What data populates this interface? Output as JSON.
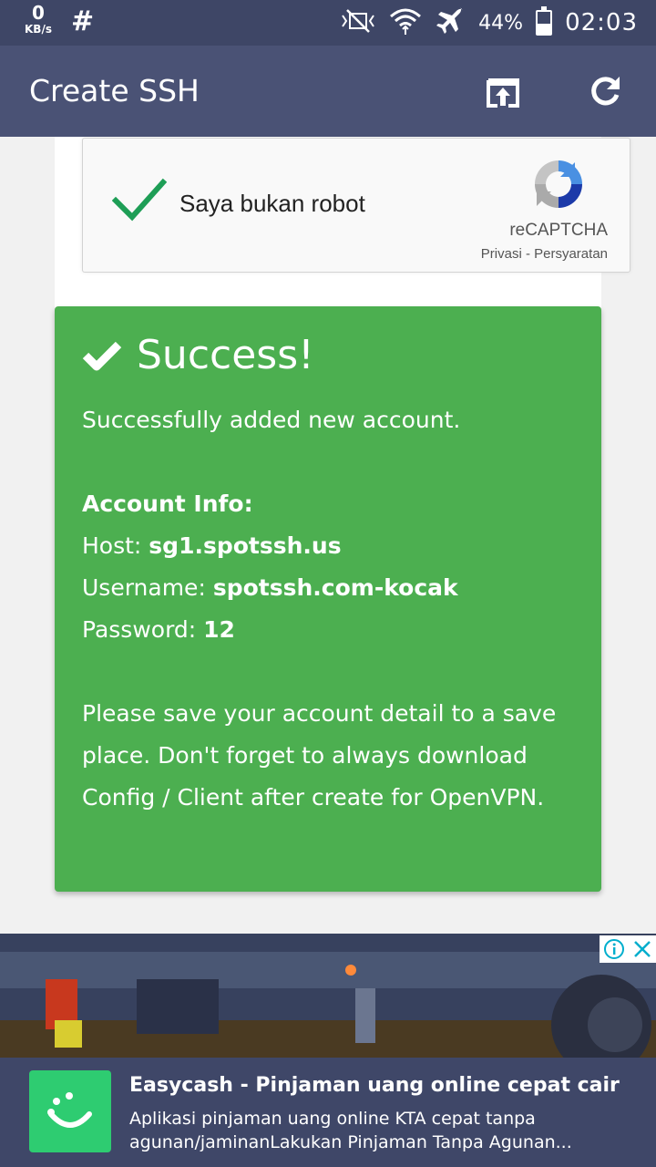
{
  "status_bar": {
    "net_speed_value": "0",
    "net_speed_unit": "KB/s",
    "hash_symbol": "#",
    "battery": "44%",
    "battery_level": 0.44,
    "time": "02:03",
    "icons": [
      "mute-icon",
      "wifi-icon",
      "airplane-icon",
      "battery-icon"
    ]
  },
  "app_bar": {
    "title": "Create SSH",
    "actions": [
      "open-in-browser-icon",
      "refresh-icon"
    ]
  },
  "recaptcha": {
    "label": "Saya bukan robot",
    "brand": "reCAPTCHA",
    "privacy": "Privasi",
    "separator": " - ",
    "terms": "Persyaratan",
    "checked": true
  },
  "alert": {
    "title": "Success!",
    "message": "Successfully added new account.",
    "info_title": "Account Info:",
    "host_label": "Host: ",
    "host_value": "sg1.spotssh.us",
    "username_label": "Username: ",
    "username_value": "spotssh.com-kocak",
    "password_label": "Password: ",
    "password_value": "12",
    "note": "Please save your account detail to a save place. Don't forget to always download Config / Client after create for OpenVPN."
  },
  "ad": {
    "title": "Easycash - Pinjaman uang online cepat cair",
    "description": "Aplikasi pinjaman uang online KTA cepat tanpa agunan/jaminanLakukan Pinjaman Tanpa Agunan...",
    "info_icon": "info-icon",
    "close_icon": "close-icon"
  },
  "colors": {
    "status_bar": "#3e4666",
    "app_bar": "#4a5275",
    "success": "#4caf50",
    "check_green": "#1e9e56",
    "ad_bar": "#3f4768",
    "ad_icon": "#2ecc71"
  }
}
